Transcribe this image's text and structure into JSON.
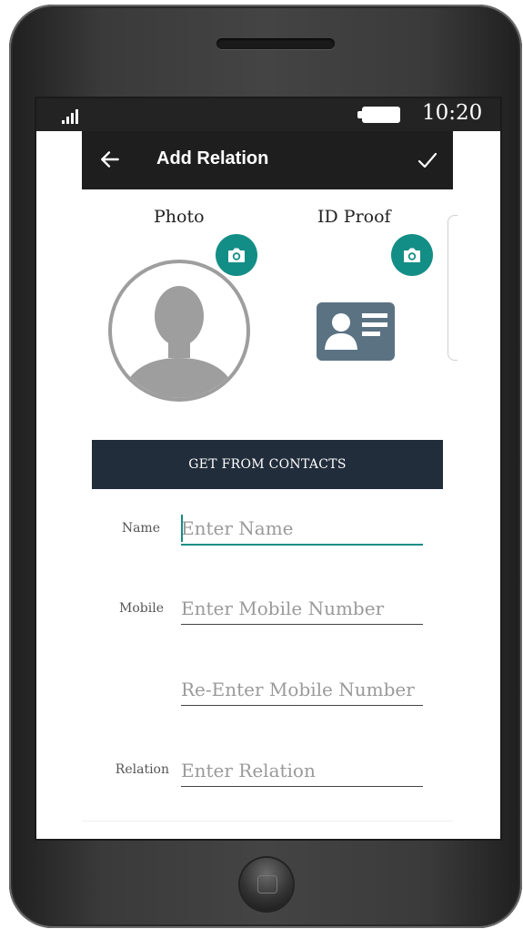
{
  "statusbar": {
    "time": "10:20",
    "signal_icon": "signal-icon",
    "battery_icon": "battery-icon"
  },
  "appbar": {
    "title": "Add Relation",
    "back_icon": "arrow-left-icon",
    "confirm_icon": "check-icon"
  },
  "media": {
    "photo_label": "Photo",
    "id_proof_label": "ID Proof",
    "photo_placeholder_icon": "person-avatar-icon",
    "id_card_icon": "id-card-icon",
    "camera_icon": "camera-icon"
  },
  "actions": {
    "get_contacts_label": "GET FROM CONTACTS"
  },
  "form": {
    "name_label": "Name",
    "name_placeholder": "Enter Name",
    "mobile_label": "Mobile",
    "mobile_placeholder": "Enter Mobile Number",
    "remobile_placeholder": "Re-Enter Mobile Number",
    "relation_label": "Relation",
    "relation_placeholder": "Enter Relation"
  },
  "colors": {
    "accent": "#138e86",
    "appbar": "#1e1e1e",
    "button": "#212d3b",
    "statusbar": "#232323"
  }
}
